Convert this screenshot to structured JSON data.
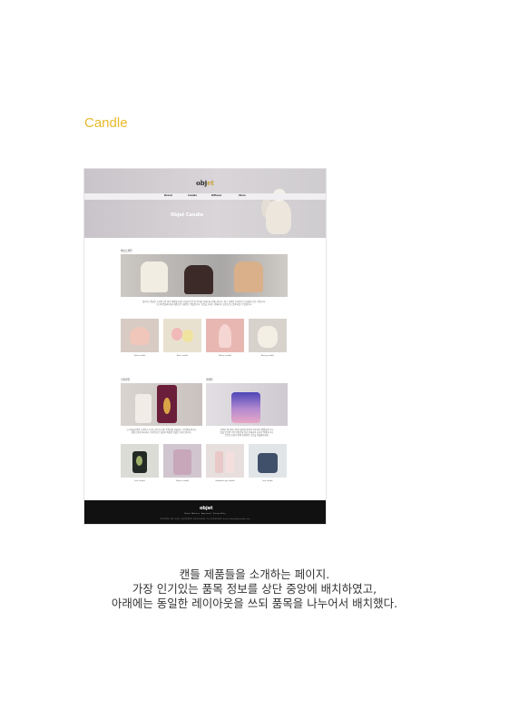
{
  "heading": "Candle",
  "mockup": {
    "logo_main": "obj",
    "logo_accent": "et",
    "nav": [
      "Brand",
      "Candle",
      "Diffuser",
      "Store"
    ],
    "hero_title": "Objet Candle",
    "best_label": "베스트캔들",
    "best_caption": [
      "클라우드캔들은 소이왁스와 천연 에센셜오일로 만들어 은은한 향기를 오래도록 전해드립니다. 작고 귀여운 디자인으로 선물용으로도 좋습니다.",
      "오브제 캔들의 대표 제품으로 사랑받는 캔들입니다. 공간을 꾸미는 인테리어 소품으로도 활용하실 수 있습니다."
    ],
    "best_items": [
      "Shell candle",
      "Rose candle",
      "Statue candle",
      "Bunny candle"
    ],
    "left_label": "가든캔들",
    "right_label": "젤캔들",
    "left_caption": [
      "드라이플라워와 소이왁스가 만나 자연스러운 분위기를 연출하는 가든캔들입니다.",
      "정성스럽게 하나하나 수작업으로 만들어 특별한 선물로 추천드립니다."
    ],
    "right_caption": [
      "투명한 젤 속에 다양한 컬러와 장식이 어우러진 젤캔들입니다.",
      "빛을 받으면 더욱 아름답게 빛나 인테리어 효과가 뛰어납니다.",
      "은은한 조명과 함께 감성적인 공간을 연출해보세요."
    ],
    "bottom_items": [
      "Leaf candle",
      "Flower candle",
      "Gradation gel candle",
      "Sea candle"
    ],
    "footer_logo": "objet",
    "footer_links": "Brand · About us · Agreement · Privacy Policy",
    "footer_info": "오브제 캔들 | 대표: 홍길동 | 사업자등록번호: 000-00-00000 | Tel: 02-000-0000 | E-mail: objet@objetcandle.com"
  },
  "description": [
    "캔들 제품들을 소개하는 페이지.",
    "가장 인기있는 품목 정보를 상단 중앙에 배치하였고,",
    "아래에는 동일한 레이아웃을 쓰되 품목을 나누어서 배치했다."
  ],
  "colors": {
    "heading": "#e8b92a",
    "footer": "#111111"
  }
}
